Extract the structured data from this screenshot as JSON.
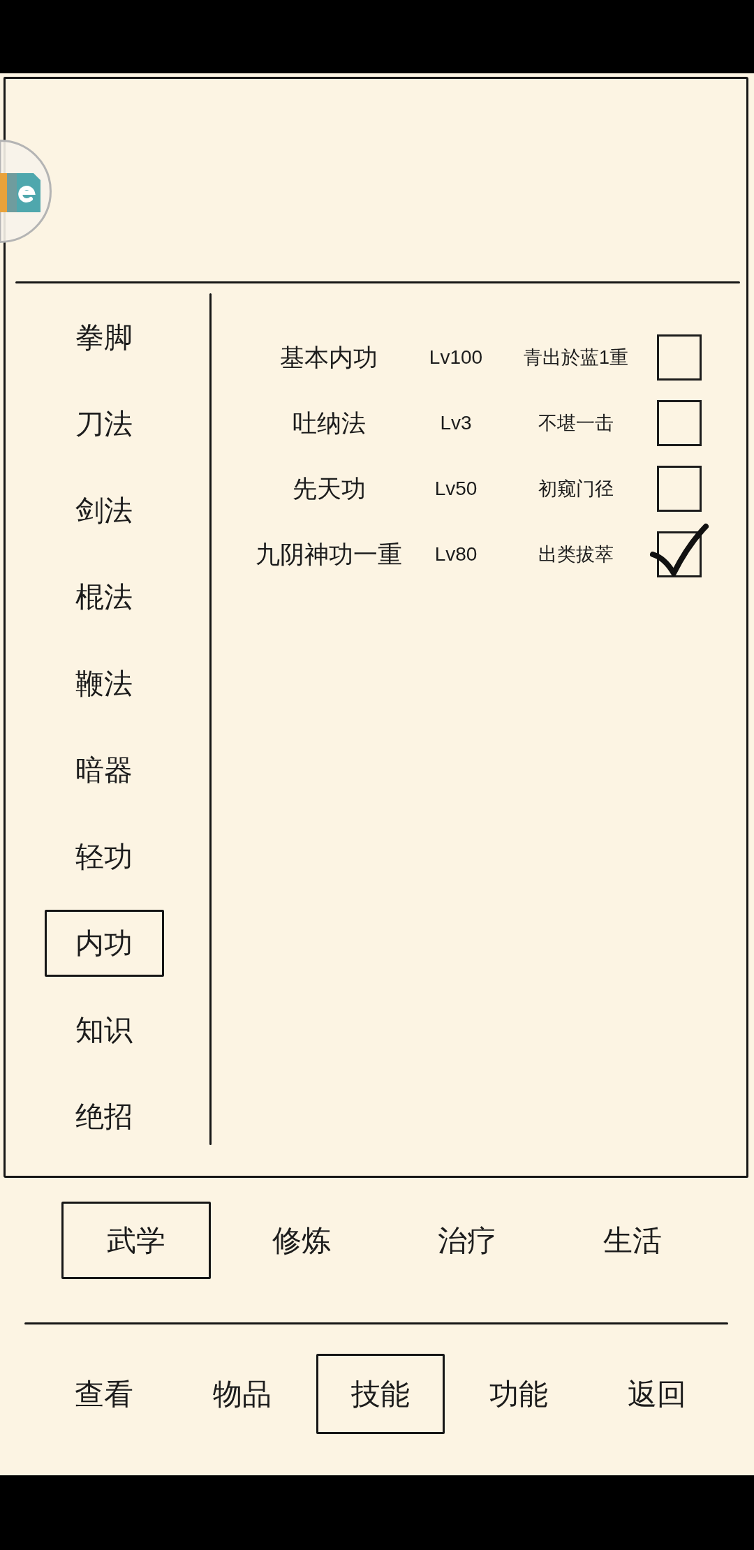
{
  "categories": [
    {
      "label": "拳脚",
      "selected": false
    },
    {
      "label": "刀法",
      "selected": false
    },
    {
      "label": "剑法",
      "selected": false
    },
    {
      "label": "棍法",
      "selected": false
    },
    {
      "label": "鞭法",
      "selected": false
    },
    {
      "label": "暗器",
      "selected": false
    },
    {
      "label": "轻功",
      "selected": false
    },
    {
      "label": "内功",
      "selected": true
    },
    {
      "label": "知识",
      "selected": false
    },
    {
      "label": "绝招",
      "selected": false
    }
  ],
  "skills": [
    {
      "name": "基本内功",
      "grade": "Lv100",
      "realm": "青出於蓝1重",
      "checked": false
    },
    {
      "name": "吐纳法",
      "grade": "Lv3",
      "realm": "不堪一击",
      "checked": false
    },
    {
      "name": "先天功",
      "grade": "Lv50",
      "realm": "初窥门径",
      "checked": false
    },
    {
      "name": "九阴神功一重",
      "grade": "Lv80",
      "realm": "出类拔萃",
      "checked": true
    }
  ],
  "skill_types": [
    {
      "label": "武学",
      "selected": true
    },
    {
      "label": "修炼",
      "selected": false
    },
    {
      "label": "治疗",
      "selected": false
    },
    {
      "label": "生活",
      "selected": false
    }
  ],
  "bottom_menu": [
    {
      "label": "查看",
      "selected": false
    },
    {
      "label": "物品",
      "selected": false
    },
    {
      "label": "技能",
      "selected": true
    },
    {
      "label": "功能",
      "selected": false
    },
    {
      "label": "返回",
      "selected": false
    }
  ]
}
